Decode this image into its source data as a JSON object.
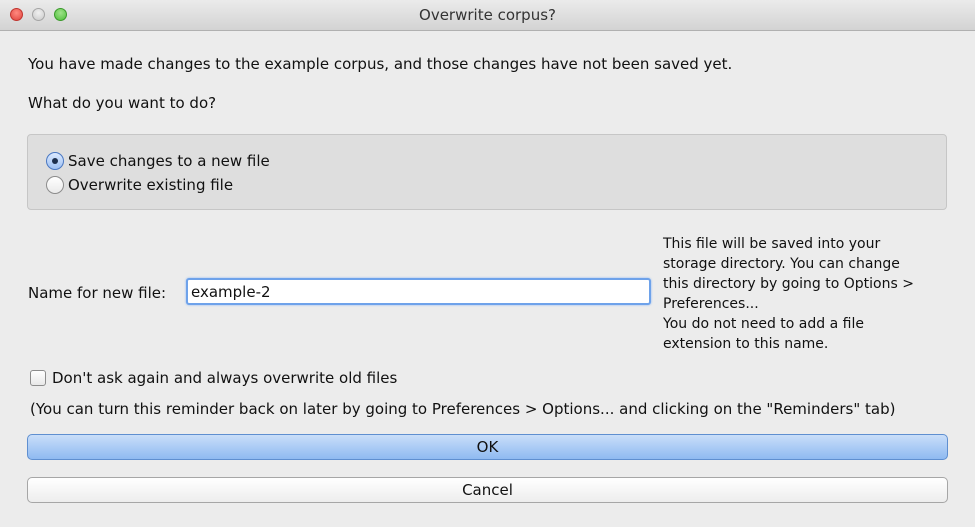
{
  "window": {
    "title": "Overwrite corpus?"
  },
  "message": "You have made changes to the example corpus, and those changes have not been saved yet.",
  "question": "What do you want to do?",
  "options": [
    {
      "label": "Save changes to a new file",
      "selected": true
    },
    {
      "label": "Overwrite existing file",
      "selected": false
    }
  ],
  "filename": {
    "label": "Name for new file:",
    "value": "example-2"
  },
  "hint": {
    "line1": "This file will be saved into your",
    "line2": "storage directory. You can change",
    "line3": "this directory by going to Options >",
    "line4": "Preferences...",
    "line5": "You do not need to add a file",
    "line6": "extension to this name."
  },
  "dont_ask": {
    "label": "Don't ask again and always overwrite old files",
    "checked": false
  },
  "reminder_note": "(You can turn this reminder back on later by going to Preferences > Options... and clicking on the \"Reminders\" tab)",
  "buttons": {
    "ok": "OK",
    "cancel": "Cancel"
  },
  "colors": {
    "ok_button": "#9fc4f3",
    "input_focus": "#6ea2ea",
    "group_bg": "#dedede"
  }
}
